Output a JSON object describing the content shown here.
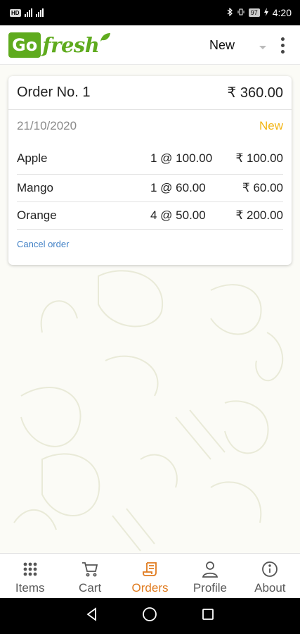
{
  "status_bar": {
    "left_badge": "HD",
    "battery": "97",
    "time": "4:20"
  },
  "app_bar": {
    "logo_go": "Go",
    "logo_fresh": "fresh",
    "filter_value": "New",
    "brand_color": "#5fab1e"
  },
  "order": {
    "title": "Order No. 1",
    "total": "₹ 360.00",
    "date": "21/10/2020",
    "status": "New",
    "status_color": "#f2b515",
    "items": [
      {
        "name": "Apple",
        "qty": "1 @ 100.00",
        "amount": "₹ 100.00"
      },
      {
        "name": "Mango",
        "qty": "1 @ 60.00",
        "amount": "₹ 60.00"
      },
      {
        "name": "Orange",
        "qty": "4 @ 50.00",
        "amount": "₹ 200.00"
      }
    ],
    "cancel_label": "Cancel order",
    "cancel_color": "#3f7fc5"
  },
  "tabs": [
    {
      "label": "Items",
      "icon": "grid-icon",
      "active": false
    },
    {
      "label": "Cart",
      "icon": "cart-icon",
      "active": false
    },
    {
      "label": "Orders",
      "icon": "receipt-icon",
      "active": true
    },
    {
      "label": "Profile",
      "icon": "person-icon",
      "active": false
    },
    {
      "label": "About",
      "icon": "info-icon",
      "active": false
    }
  ],
  "active_color": "#e07b1f"
}
